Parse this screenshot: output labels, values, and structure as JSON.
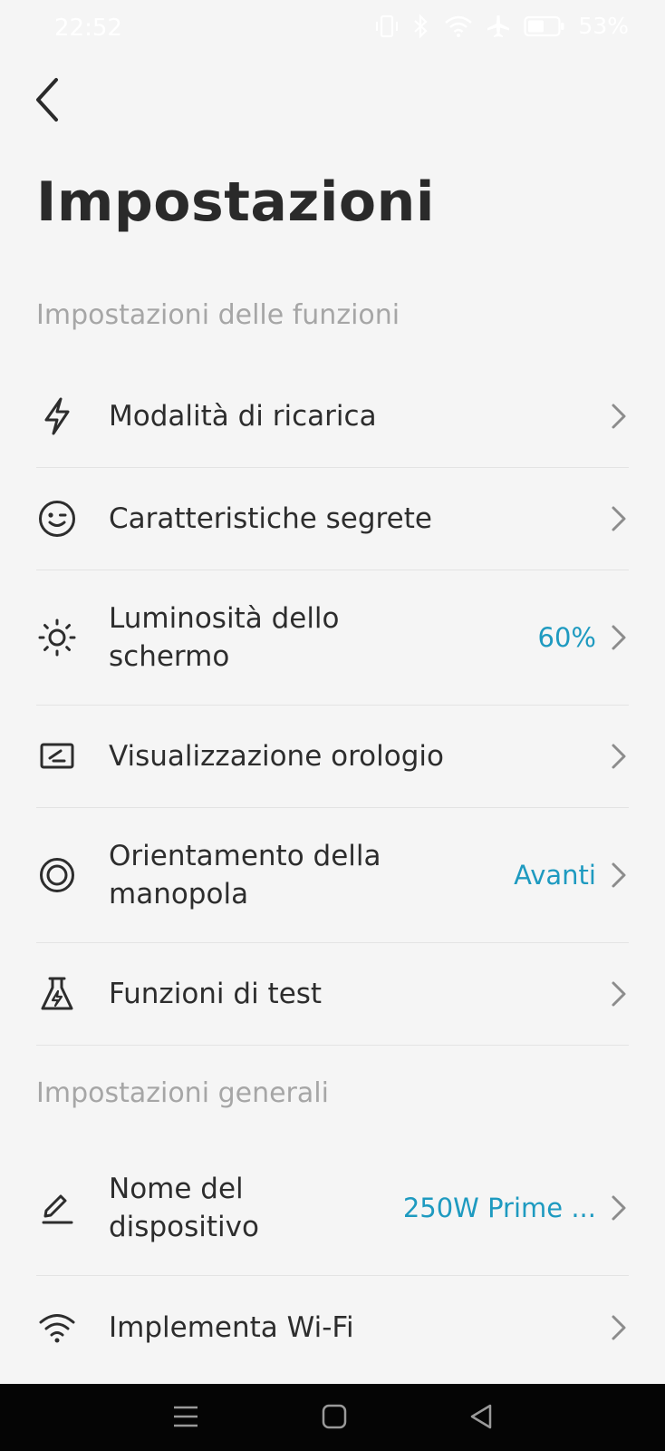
{
  "status_bar": {
    "time": "22:52",
    "battery": "53%",
    "icons": [
      "vibrate-icon",
      "bluetooth-icon",
      "wifi-icon",
      "airplane-icon",
      "battery-icon"
    ]
  },
  "header": {
    "title": "Impostazioni"
  },
  "sections": [
    {
      "title": "Impostazioni delle funzioni",
      "items": [
        {
          "icon": "lightning-icon",
          "label": "Modalità di ricarica",
          "value": ""
        },
        {
          "icon": "wink-face-icon",
          "label": "Caratteristiche segrete",
          "value": ""
        },
        {
          "icon": "sun-icon",
          "label_line1": "Luminosità dello",
          "label_line2": "schermo",
          "value": "60%"
        },
        {
          "icon": "clock-display-icon",
          "label": "Visualizzazione orologio",
          "value": ""
        },
        {
          "icon": "knob-icon",
          "label_line1": "Orientamento della",
          "label_line2": "manopola",
          "value": "Avanti"
        },
        {
          "icon": "flask-icon",
          "label": "Funzioni di test",
          "value": ""
        }
      ]
    },
    {
      "title": "Impostazioni generali",
      "items": [
        {
          "icon": "pencil-icon",
          "label_line1": "Nome del",
          "label_line2": "dispositivo",
          "value": "250W Prime ..."
        },
        {
          "icon": "wifi-icon",
          "label": "Implementa Wi-Fi",
          "value": ""
        }
      ]
    }
  ],
  "colors": {
    "background": "#f5f5f5",
    "accent_value": "#1e9ac0",
    "section_header": "#a6a6a6",
    "navbar": "#050505"
  }
}
